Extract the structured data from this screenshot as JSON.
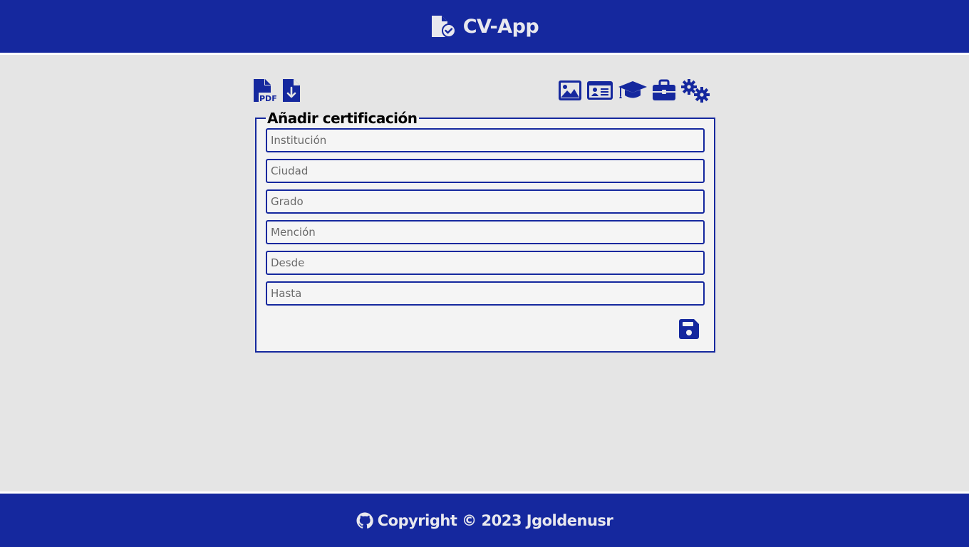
{
  "header": {
    "title": "CV-App",
    "logo_icon": "file-check-icon"
  },
  "toolbar": {
    "left": [
      {
        "icon": "file-pdf-icon"
      },
      {
        "icon": "file-download-icon"
      }
    ],
    "right": [
      {
        "icon": "image-icon"
      },
      {
        "icon": "id-card-icon"
      },
      {
        "icon": "graduation-cap-icon"
      },
      {
        "icon": "briefcase-icon"
      },
      {
        "icon": "gears-icon"
      }
    ]
  },
  "form": {
    "legend": "Añadir certificación",
    "fields": [
      {
        "placeholder": "Institución",
        "value": ""
      },
      {
        "placeholder": "Ciudad",
        "value": ""
      },
      {
        "placeholder": "Grado",
        "value": ""
      },
      {
        "placeholder": "Mención",
        "value": ""
      },
      {
        "placeholder": "Desde",
        "value": ""
      },
      {
        "placeholder": "Hasta",
        "value": ""
      }
    ],
    "save_icon": "floppy-disk-icon"
  },
  "footer": {
    "text": "Copyright © 2023 Jgoldenusr",
    "icon": "github-icon"
  },
  "colors": {
    "brand": "#15289e",
    "background": "#e5e5e5",
    "panel": "#f3f3f3",
    "header_text": "#e8e8ee"
  }
}
